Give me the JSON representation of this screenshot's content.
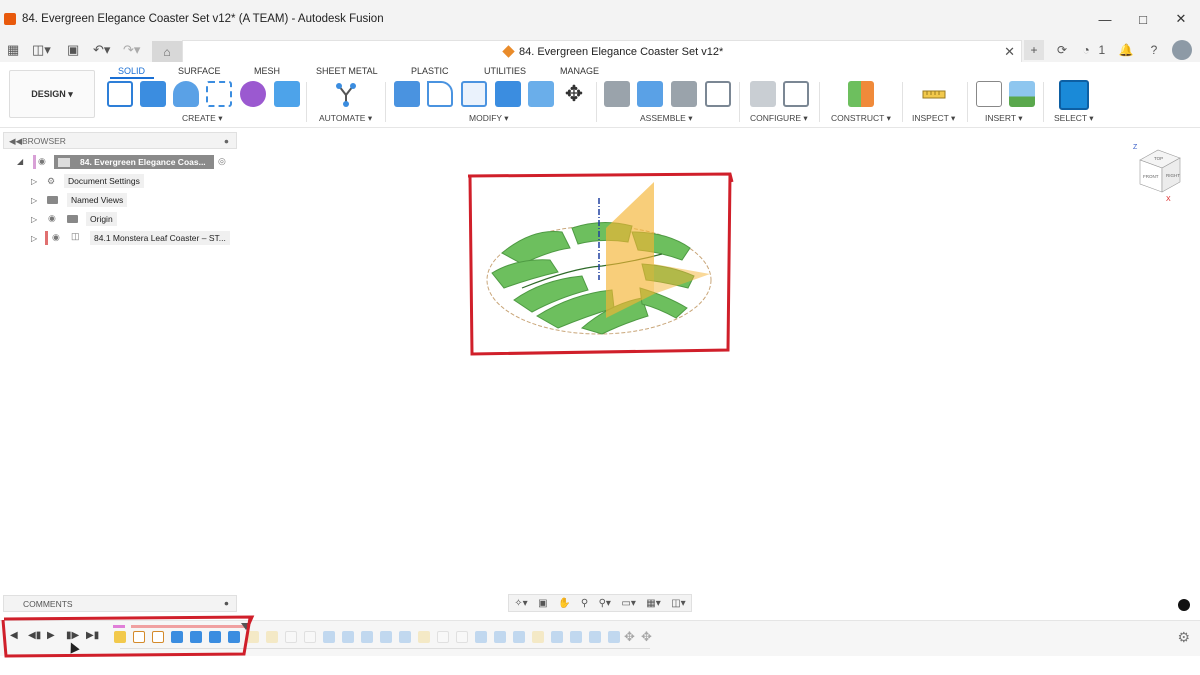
{
  "window": {
    "title": "84. Evergreen Elegance Coaster Set v12* (A TEAM) - Autodesk Fusion",
    "controls": [
      "minimize-icon",
      "maximize-icon",
      "close-icon"
    ]
  },
  "doc_tab": {
    "title": "84. Evergreen Elegance Coaster Set v12*",
    "close": "✕"
  },
  "toolbar": {
    "workspace": "DESIGN",
    "tabs": [
      "SOLID",
      "SURFACE",
      "MESH",
      "SHEET METAL",
      "PLASTIC",
      "UTILITIES",
      "MANAGE"
    ],
    "active_tab": "SOLID",
    "groups": [
      "CREATE",
      "AUTOMATE",
      "MODIFY",
      "ASSEMBLE",
      "CONFIGURE",
      "CONSTRUCT",
      "INSPECT",
      "INSERT",
      "SELECT"
    ]
  },
  "header_right": {
    "notification_count": "1"
  },
  "browser": {
    "title": "BROWSER",
    "root": "84. Evergreen Elegance Coas...",
    "items": [
      {
        "label": "Document Settings"
      },
      {
        "label": "Named Views"
      },
      {
        "label": "Origin"
      },
      {
        "label": "84.1 Monstera Leaf Coaster – ST..."
      }
    ]
  },
  "comments": {
    "title": "COMMENTS"
  },
  "viewcube": {
    "top": "TOP",
    "front": "FRONT",
    "right": "RIGHT",
    "z": "Z",
    "x": "X"
  },
  "colors": {
    "accent": "#1a6fd4",
    "annotation": "#d01f2a",
    "leaf": "#6dbf5e",
    "plane": "#f5b333"
  }
}
